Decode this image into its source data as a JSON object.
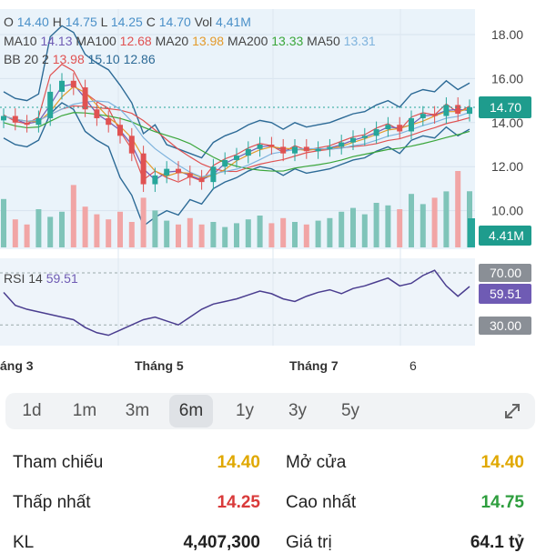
{
  "header": {
    "ohlc": [
      {
        "label": "O",
        "value": "14.40"
      },
      {
        "label": "H",
        "value": "14.75"
      },
      {
        "label": "L",
        "value": "14.25"
      },
      {
        "label": "C",
        "value": "14.70"
      },
      {
        "label": "Vol",
        "value": "4,41M"
      }
    ],
    "ma": [
      {
        "label": "MA10",
        "value": "14.13",
        "color": "#6f5bb4"
      },
      {
        "label": "MA100",
        "value": "12.68",
        "color": "#e05252"
      },
      {
        "label": "MA20",
        "value": "13.98",
        "color": "#e39a2b"
      },
      {
        "label": "MA200",
        "value": "13.33",
        "color": "#3aa63a"
      },
      {
        "label": "MA50",
        "value": "13.31",
        "color": "#7fb3dd"
      }
    ],
    "bb": {
      "label": "BB 20 2",
      "upper": "13.98",
      "middle": "15.10",
      "lower": "12.86"
    }
  },
  "chart_data": {
    "type": "candlestick",
    "price_ticks": [
      "18.00",
      "16.00",
      "14.00",
      "12.00",
      "10.00"
    ],
    "last_price": "14.70",
    "volume_label": "4.41M",
    "rsi": {
      "label": "RSI 14",
      "value": "59.51",
      "levels": [
        "70.00",
        "30.00"
      ]
    },
    "x_labels": [
      "áng 3",
      "Tháng 5",
      "Tháng 7",
      "6"
    ],
    "approx_closes": [
      14.3,
      14.0,
      13.9,
      14.2,
      15.4,
      15.9,
      15.6,
      14.6,
      14.2,
      13.9,
      13.4,
      12.6,
      11.2,
      11.6,
      11.9,
      11.7,
      11.5,
      11.3,
      12.0,
      12.3,
      12.5,
      12.8,
      13.0,
      12.9,
      12.6,
      12.9,
      12.7,
      12.8,
      12.9,
      13.1,
      13.3,
      13.4,
      13.7,
      13.9,
      13.6,
      14.2,
      14.4,
      14.3,
      14.8,
      14.4,
      14.7
    ],
    "volumes": [
      3.8,
      2.2,
      1.8,
      3.0,
      2.4,
      2.8,
      4.9,
      3.2,
      2.6,
      2.2,
      2.8,
      2.0,
      3.9,
      2.9,
      2.1,
      1.8,
      2.3,
      1.8,
      2.0,
      1.6,
      1.9,
      2.2,
      2.5,
      1.9,
      2.3,
      2.0,
      1.8,
      2.1,
      2.3,
      2.8,
      3.1,
      2.6,
      3.5,
      3.3,
      3.0,
      4.2,
      3.4,
      3.9,
      4.4,
      6.0,
      4.41
    ],
    "rsi_values": [
      55,
      45,
      42,
      40,
      38,
      36,
      34,
      28,
      24,
      22,
      26,
      30,
      34,
      36,
      33,
      30,
      36,
      42,
      46,
      48,
      50,
      53,
      56,
      54,
      50,
      48,
      52,
      55,
      57,
      54,
      58,
      60,
      63,
      66,
      60,
      62,
      68,
      72,
      60,
      52,
      59.51
    ]
  },
  "ranges": [
    {
      "label": "1d",
      "active": false
    },
    {
      "label": "1m",
      "active": false
    },
    {
      "label": "3m",
      "active": false
    },
    {
      "label": "6m",
      "active": true
    },
    {
      "label": "1y",
      "active": false
    },
    {
      "label": "3y",
      "active": false
    },
    {
      "label": "5y",
      "active": false
    }
  ],
  "stats": [
    {
      "label": "Tham chiếu",
      "value": "14.40",
      "color": "#e0a800"
    },
    {
      "label": "Mở cửa",
      "value": "14.40",
      "color": "#e0a800"
    },
    {
      "label": "Thấp nhất",
      "value": "14.25",
      "color": "#d93a3a"
    },
    {
      "label": "Cao nhất",
      "value": "14.75",
      "color": "#2e9e3e"
    },
    {
      "label": "KL",
      "value": "4,407,300",
      "color": "#222222"
    },
    {
      "label": "Giá trị",
      "value": "64.1 tỷ",
      "color": "#222222"
    }
  ],
  "colors": {
    "up": "#26a69a",
    "down": "#e05252",
    "plot_bg": "#eaf3fa",
    "rsi_line": "#4a3d8f",
    "volume_up": "#7fc4b9",
    "volume_down": "#f1a5a5"
  }
}
